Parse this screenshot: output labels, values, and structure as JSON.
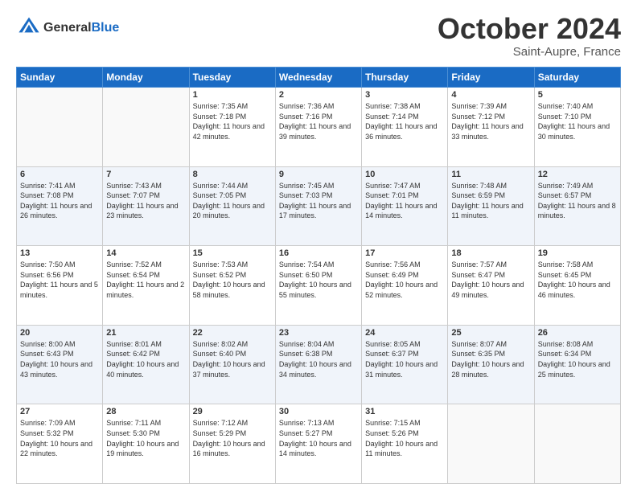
{
  "header": {
    "logo_general": "General",
    "logo_blue": "Blue",
    "month_title": "October 2024",
    "location": "Saint-Aupre, France"
  },
  "days_of_week": [
    "Sunday",
    "Monday",
    "Tuesday",
    "Wednesday",
    "Thursday",
    "Friday",
    "Saturday"
  ],
  "weeks": [
    [
      {
        "day": "",
        "info": ""
      },
      {
        "day": "",
        "info": ""
      },
      {
        "day": "1",
        "info": "Sunrise: 7:35 AM\nSunset: 7:18 PM\nDaylight: 11 hours and 42 minutes."
      },
      {
        "day": "2",
        "info": "Sunrise: 7:36 AM\nSunset: 7:16 PM\nDaylight: 11 hours and 39 minutes."
      },
      {
        "day": "3",
        "info": "Sunrise: 7:38 AM\nSunset: 7:14 PM\nDaylight: 11 hours and 36 minutes."
      },
      {
        "day": "4",
        "info": "Sunrise: 7:39 AM\nSunset: 7:12 PM\nDaylight: 11 hours and 33 minutes."
      },
      {
        "day": "5",
        "info": "Sunrise: 7:40 AM\nSunset: 7:10 PM\nDaylight: 11 hours and 30 minutes."
      }
    ],
    [
      {
        "day": "6",
        "info": "Sunrise: 7:41 AM\nSunset: 7:08 PM\nDaylight: 11 hours and 26 minutes."
      },
      {
        "day": "7",
        "info": "Sunrise: 7:43 AM\nSunset: 7:07 PM\nDaylight: 11 hours and 23 minutes."
      },
      {
        "day": "8",
        "info": "Sunrise: 7:44 AM\nSunset: 7:05 PM\nDaylight: 11 hours and 20 minutes."
      },
      {
        "day": "9",
        "info": "Sunrise: 7:45 AM\nSunset: 7:03 PM\nDaylight: 11 hours and 17 minutes."
      },
      {
        "day": "10",
        "info": "Sunrise: 7:47 AM\nSunset: 7:01 PM\nDaylight: 11 hours and 14 minutes."
      },
      {
        "day": "11",
        "info": "Sunrise: 7:48 AM\nSunset: 6:59 PM\nDaylight: 11 hours and 11 minutes."
      },
      {
        "day": "12",
        "info": "Sunrise: 7:49 AM\nSunset: 6:57 PM\nDaylight: 11 hours and 8 minutes."
      }
    ],
    [
      {
        "day": "13",
        "info": "Sunrise: 7:50 AM\nSunset: 6:56 PM\nDaylight: 11 hours and 5 minutes."
      },
      {
        "day": "14",
        "info": "Sunrise: 7:52 AM\nSunset: 6:54 PM\nDaylight: 11 hours and 2 minutes."
      },
      {
        "day": "15",
        "info": "Sunrise: 7:53 AM\nSunset: 6:52 PM\nDaylight: 10 hours and 58 minutes."
      },
      {
        "day": "16",
        "info": "Sunrise: 7:54 AM\nSunset: 6:50 PM\nDaylight: 10 hours and 55 minutes."
      },
      {
        "day": "17",
        "info": "Sunrise: 7:56 AM\nSunset: 6:49 PM\nDaylight: 10 hours and 52 minutes."
      },
      {
        "day": "18",
        "info": "Sunrise: 7:57 AM\nSunset: 6:47 PM\nDaylight: 10 hours and 49 minutes."
      },
      {
        "day": "19",
        "info": "Sunrise: 7:58 AM\nSunset: 6:45 PM\nDaylight: 10 hours and 46 minutes."
      }
    ],
    [
      {
        "day": "20",
        "info": "Sunrise: 8:00 AM\nSunset: 6:43 PM\nDaylight: 10 hours and 43 minutes."
      },
      {
        "day": "21",
        "info": "Sunrise: 8:01 AM\nSunset: 6:42 PM\nDaylight: 10 hours and 40 minutes."
      },
      {
        "day": "22",
        "info": "Sunrise: 8:02 AM\nSunset: 6:40 PM\nDaylight: 10 hours and 37 minutes."
      },
      {
        "day": "23",
        "info": "Sunrise: 8:04 AM\nSunset: 6:38 PM\nDaylight: 10 hours and 34 minutes."
      },
      {
        "day": "24",
        "info": "Sunrise: 8:05 AM\nSunset: 6:37 PM\nDaylight: 10 hours and 31 minutes."
      },
      {
        "day": "25",
        "info": "Sunrise: 8:07 AM\nSunset: 6:35 PM\nDaylight: 10 hours and 28 minutes."
      },
      {
        "day": "26",
        "info": "Sunrise: 8:08 AM\nSunset: 6:34 PM\nDaylight: 10 hours and 25 minutes."
      }
    ],
    [
      {
        "day": "27",
        "info": "Sunrise: 7:09 AM\nSunset: 5:32 PM\nDaylight: 10 hours and 22 minutes."
      },
      {
        "day": "28",
        "info": "Sunrise: 7:11 AM\nSunset: 5:30 PM\nDaylight: 10 hours and 19 minutes."
      },
      {
        "day": "29",
        "info": "Sunrise: 7:12 AM\nSunset: 5:29 PM\nDaylight: 10 hours and 16 minutes."
      },
      {
        "day": "30",
        "info": "Sunrise: 7:13 AM\nSunset: 5:27 PM\nDaylight: 10 hours and 14 minutes."
      },
      {
        "day": "31",
        "info": "Sunrise: 7:15 AM\nSunset: 5:26 PM\nDaylight: 10 hours and 11 minutes."
      },
      {
        "day": "",
        "info": ""
      },
      {
        "day": "",
        "info": ""
      }
    ]
  ]
}
